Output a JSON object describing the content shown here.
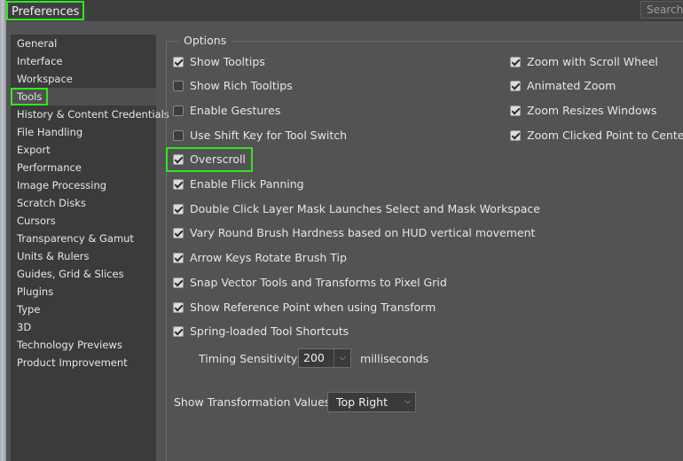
{
  "window": {
    "title": "Preferences",
    "search_placeholder": "Search"
  },
  "sidebar": {
    "items": [
      {
        "label": "General"
      },
      {
        "label": "Interface"
      },
      {
        "label": "Workspace"
      },
      {
        "label": "Tools",
        "selected": true
      },
      {
        "label": "History & Content Credentials"
      },
      {
        "label": "File Handling"
      },
      {
        "label": "Export"
      },
      {
        "label": "Performance"
      },
      {
        "label": "Image Processing"
      },
      {
        "label": "Scratch Disks"
      },
      {
        "label": "Cursors"
      },
      {
        "label": "Transparency & Gamut"
      },
      {
        "label": "Units & Rulers"
      },
      {
        "label": "Guides, Grid & Slices"
      },
      {
        "label": "Plugins"
      },
      {
        "label": "Type"
      },
      {
        "label": "3D"
      },
      {
        "label": "Technology Previews"
      },
      {
        "label": "Product Improvement"
      }
    ]
  },
  "options": {
    "group_label": "Options",
    "left": [
      {
        "label": "Show Tooltips",
        "checked": true
      },
      {
        "label": "Show Rich Tooltips",
        "checked": false
      },
      {
        "label": "Enable Gestures",
        "checked": false
      },
      {
        "label": "Use Shift Key for Tool Switch",
        "checked": false
      },
      {
        "label": "Overscroll",
        "checked": true
      },
      {
        "label": "Enable Flick Panning",
        "checked": true
      },
      {
        "label": "Double Click Layer Mask Launches Select and Mask Workspace",
        "checked": true
      },
      {
        "label": "Vary Round Brush Hardness based on HUD vertical movement",
        "checked": true
      },
      {
        "label": "Arrow Keys Rotate Brush Tip",
        "checked": true
      },
      {
        "label": "Snap Vector Tools and Transforms to Pixel Grid",
        "checked": true
      },
      {
        "label": "Show Reference Point when using Transform",
        "checked": true
      },
      {
        "label": "Spring-loaded Tool Shortcuts",
        "checked": true
      }
    ],
    "right": [
      {
        "label": "Zoom with Scroll Wheel",
        "checked": true
      },
      {
        "label": "Animated Zoom",
        "checked": true
      },
      {
        "label": "Zoom Resizes Windows",
        "checked": true
      },
      {
        "label": "Zoom Clicked Point to Center",
        "checked": true
      }
    ],
    "timing": {
      "label": "Timing Sensitivity:",
      "value": "200",
      "unit": "milliseconds"
    },
    "transformation": {
      "label": "Show Transformation Values:",
      "value": "Top Right"
    }
  },
  "colors": {
    "highlight": "#32e61e",
    "background": "#535353",
    "sidebar_bg": "#3b3b3b"
  }
}
